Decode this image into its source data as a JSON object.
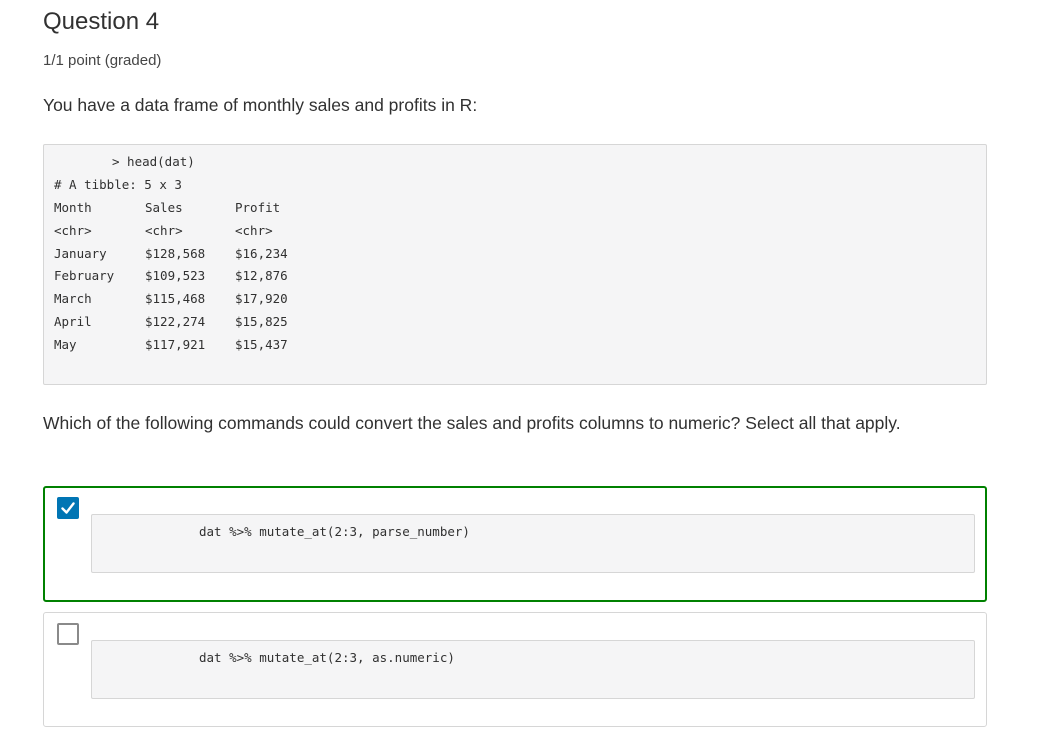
{
  "question": {
    "title": "Question 4",
    "points": "1/1 point (graded)",
    "prompt": "You have a data frame of monthly sales and profits in R:",
    "code_command": "> head(dat)",
    "tibble_header": "# A tibble: 5 x 3",
    "table": {
      "columns": [
        "Month",
        "Sales",
        "Profit"
      ],
      "types": [
        "<chr>",
        "<chr>",
        "<chr>"
      ],
      "rows": [
        [
          "January",
          "$128,568",
          "$16,234"
        ],
        [
          "February",
          "$109,523",
          "$12,876"
        ],
        [
          "March",
          "$115,468",
          "$17,920"
        ],
        [
          "April",
          "$122,274",
          "$15,825"
        ],
        [
          "May",
          "$117,921",
          "$15,437"
        ]
      ]
    },
    "instruction": "Which of the following commands could convert the sales and profits columns to numeric? Select all that apply.",
    "options": [
      {
        "code": "dat %>% mutate_at(2:3, parse_number)",
        "checked": true
      },
      {
        "code": "dat %>% mutate_at(2:3, as.numeric)",
        "checked": false
      }
    ]
  },
  "colors": {
    "selected_border": "#008100",
    "checkbox_fill": "#0075b4",
    "code_background": "#f5f5f6"
  },
  "icons": {
    "checked": "checkmark-icon"
  }
}
